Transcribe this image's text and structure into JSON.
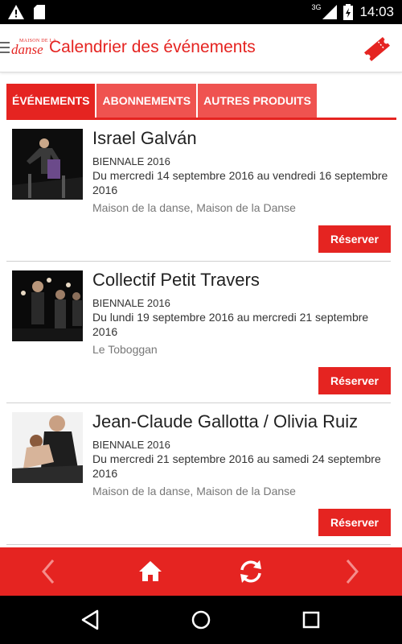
{
  "status_bar": {
    "network": "3G",
    "time": "14:03"
  },
  "app_bar": {
    "logo_small": "MAISON DE LA",
    "logo_big": "danse",
    "title": "Calendrier des événements"
  },
  "tabs": [
    {
      "label": "ÉVÉNEMENTS",
      "active": true
    },
    {
      "label": "ABONNEMENTS",
      "active": false
    },
    {
      "label": "AUTRES PRODUITS",
      "active": false
    }
  ],
  "events": [
    {
      "title": "Israel Galván",
      "category": "BIENNALE 2016",
      "dates": "Du mercredi 14 septembre 2016 au vendredi 16 septembre 2016",
      "venue": "Maison de la danse, Maison de la Danse",
      "button": "Réserver"
    },
    {
      "title": "Collectif Petit Travers",
      "category": "BIENNALE 2016",
      "dates": "Du lundi 19 septembre 2016 au mercredi 21 septembre 2016",
      "venue": "Le Toboggan",
      "button": "Réserver"
    },
    {
      "title": "Jean-Claude Gallotta / Olivia Ruiz",
      "category": "BIENNALE 2016",
      "dates": "Du mercredi 21 septembre 2016 au samedi 24 septembre 2016",
      "venue": "Maison de la danse, Maison de la Danse",
      "button": "Réserver"
    }
  ],
  "colors": {
    "accent": "#e52421",
    "tab_inactive": "#ef5350"
  },
  "icons": {
    "status_left": [
      "warning-icon",
      "sd-card-icon"
    ],
    "status_right": [
      "signal-icon",
      "battery-icon"
    ],
    "app_bar": [
      "menu-icon",
      "ticket-icon"
    ],
    "bottom_bar": [
      "back-arrow-icon",
      "home-icon",
      "refresh-icon",
      "forward-arrow-icon"
    ],
    "nav_bar": [
      "nav-back-icon",
      "nav-home-icon",
      "nav-recents-icon"
    ]
  }
}
